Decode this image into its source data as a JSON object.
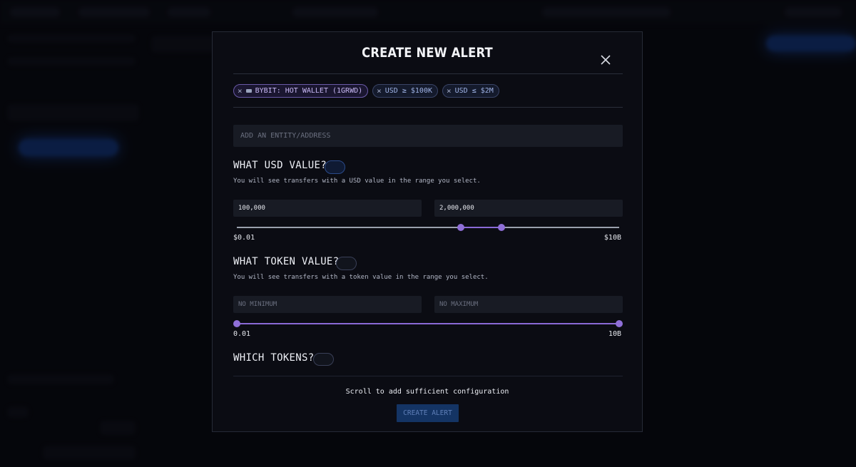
{
  "modal": {
    "title": "CREATE NEW ALERT",
    "close_icon": "close-icon"
  },
  "filters": [
    {
      "label": "BYBIT: HOT WALLET (1GRWD)",
      "icon": "wallet-icon",
      "type": "entity"
    },
    {
      "label": "USD ≥ $100K",
      "type": "value"
    },
    {
      "label": "USD ≤ $2M",
      "type": "value"
    }
  ],
  "entity_input": {
    "placeholder": "ADD AN ENTITY/ADDRESS",
    "value": ""
  },
  "usd_section": {
    "title": "WHAT USD VALUE?",
    "hint": "You will see transfers with a USD value in the range you select.",
    "min_value": "100,000",
    "max_value": "2,000,000",
    "range_min_label": "$0.01",
    "range_max_label": "$10B",
    "slider_low_fraction": 0.585,
    "slider_high_fraction": 0.693
  },
  "token_section": {
    "title": "WHAT TOKEN VALUE?",
    "hint": "You will see transfers with a token value in the range you select.",
    "min_placeholder": "NO MINIMUM",
    "max_placeholder": "NO MAXIMUM",
    "range_min_label": "0.01",
    "range_max_label": "10B",
    "slider_low_fraction": 0.0,
    "slider_high_fraction": 1.0
  },
  "tokens_section": {
    "title": "WHICH TOKENS?"
  },
  "footer": {
    "scroll_note": "Scroll to add sufficient configuration",
    "create_button": "CREATE ALERT"
  },
  "colors": {
    "accent": "#8f6fd8",
    "button": "#143464",
    "background": "#0b0c13"
  }
}
